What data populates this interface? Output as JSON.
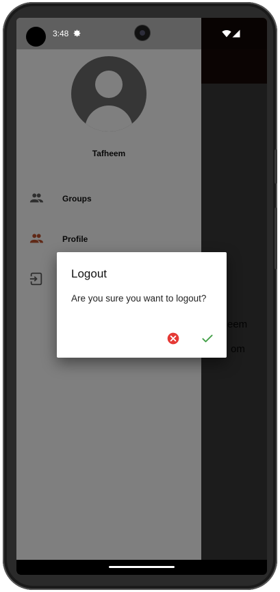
{
  "status_bar": {
    "time": "3:48",
    "icons": [
      "gear-icon",
      "wifi-icon",
      "cellular-signal-icon"
    ]
  },
  "drawer": {
    "user_name": "Tafheem",
    "avatar_icon": "account-circle-icon",
    "items": [
      {
        "label": "Groups",
        "icon": "group-icon",
        "icon_color": "#5f5f5f"
      },
      {
        "label": "Profile",
        "icon": "group-icon",
        "icon_color": "#c0532f"
      },
      {
        "label": "",
        "icon": "logout-icon",
        "icon_color": "#5f5f5f"
      }
    ]
  },
  "background_app": {
    "bar_color": "#6b2b1c",
    "text_1": "eem",
    "text_2": "om"
  },
  "dialog": {
    "title": "Logout",
    "message": "Are you sure you want to logout?",
    "cancel_icon": "cancel-circle-icon",
    "cancel_color": "#e53935",
    "confirm_icon": "check-icon",
    "confirm_color": "#43a047"
  }
}
